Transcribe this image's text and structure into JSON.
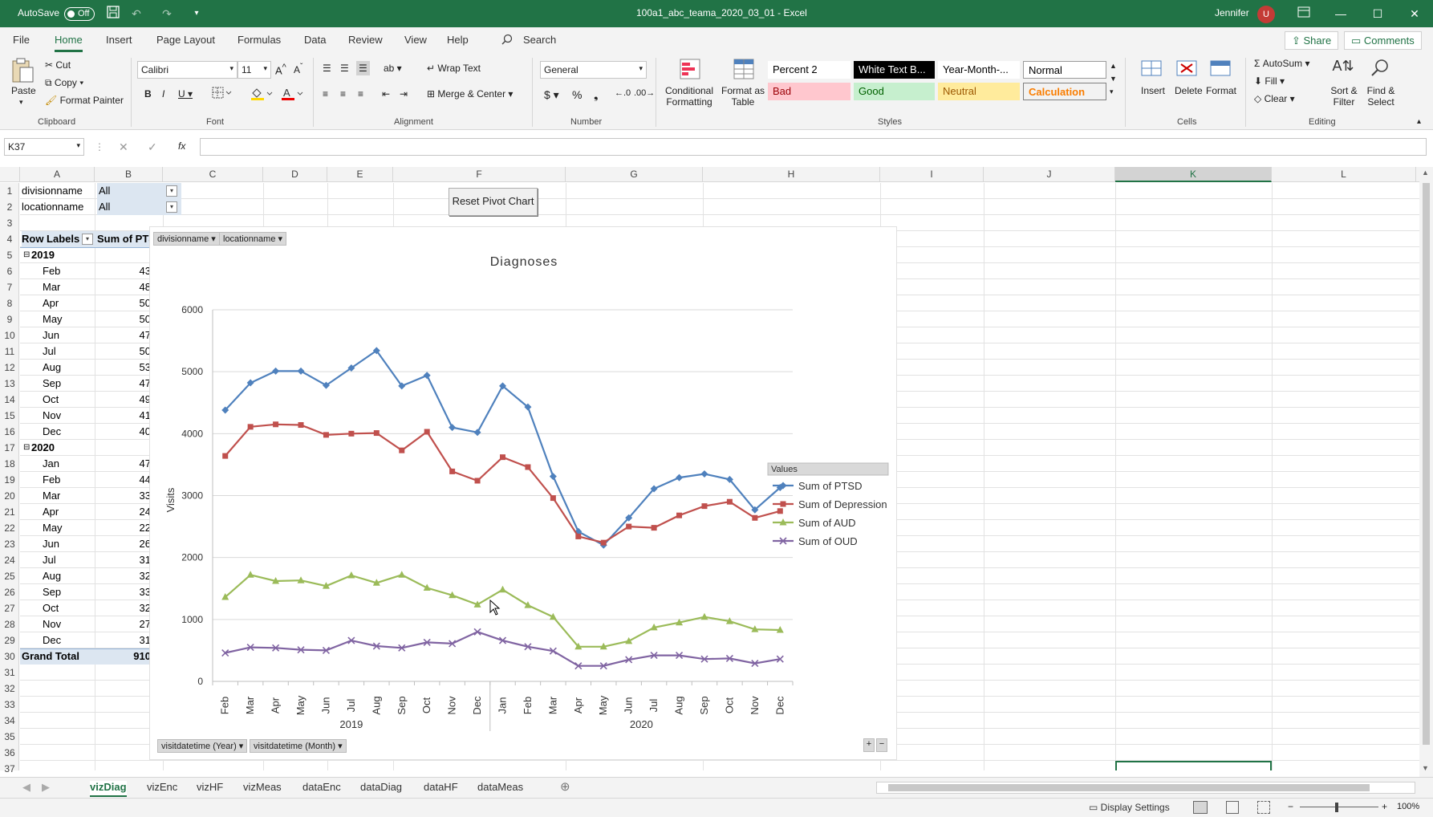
{
  "titlebar": {
    "autosave_label": "AutoSave",
    "autosave_state": "Off",
    "document_title": "100a1_abc_teama_2020_03_01  -  Excel",
    "user_name": "Jennifer",
    "user_initials": "U"
  },
  "menu": {
    "tabs": [
      "File",
      "Home",
      "Insert",
      "Page Layout",
      "Formulas",
      "Data",
      "Review",
      "View",
      "Help"
    ],
    "search_label": "Search",
    "share_label": "Share",
    "comments_label": "Comments"
  },
  "ribbon": {
    "clipboard": {
      "paste": "Paste",
      "cut": "Cut",
      "copy": "Copy",
      "format_painter": "Format Painter",
      "label": "Clipboard"
    },
    "font": {
      "name": "Calibri",
      "size": "11",
      "label": "Font"
    },
    "alignment": {
      "wrap_text": "Wrap Text",
      "merge_center": "Merge & Center",
      "label": "Alignment"
    },
    "number": {
      "format": "General",
      "label": "Number"
    },
    "styles": {
      "conditional": "Conditional Formatting",
      "format_table": "Format as Table",
      "cells": [
        "Percent 2",
        "White Text B...",
        "Year-Month-...",
        "Normal",
        "Bad",
        "Good",
        "Neutral",
        "Calculation"
      ],
      "label": "Styles"
    },
    "cells": {
      "insert": "Insert",
      "delete": "Delete",
      "format": "Format",
      "label": "Cells"
    },
    "editing": {
      "autosum": "AutoSum",
      "fill": "Fill",
      "clear": "Clear",
      "sort_filter": "Sort & Filter",
      "find_select": "Find & Select",
      "label": "Editing"
    }
  },
  "formula_bar": {
    "name_box": "K37",
    "fx": "fx",
    "value": ""
  },
  "columns": [
    "A",
    "B",
    "C",
    "D",
    "E",
    "F",
    "G",
    "H",
    "I",
    "J",
    "K",
    "L"
  ],
  "rows": [
    "1",
    "2",
    "3",
    "4",
    "5",
    "6",
    "7",
    "8",
    "9",
    "10",
    "11",
    "12",
    "13",
    "14",
    "15",
    "16",
    "17",
    "18",
    "19",
    "20",
    "21",
    "22",
    "23",
    "24",
    "25",
    "26",
    "27",
    "28",
    "29",
    "30",
    "31",
    "32",
    "33",
    "34",
    "35",
    "36",
    "37"
  ],
  "pivot": {
    "filter1_name": "divisionname",
    "filter1_value": "All",
    "filter2_name": "locationname",
    "filter2_value": "All",
    "row_labels": "Row Labels",
    "sum_header": "Sum of PTS",
    "year1": "2019",
    "year1_rows": [
      [
        "Feb",
        "43"
      ],
      [
        "Mar",
        "48"
      ],
      [
        "Apr",
        "50"
      ],
      [
        "May",
        "50"
      ],
      [
        "Jun",
        "47"
      ],
      [
        "Jul",
        "50"
      ],
      [
        "Aug",
        "53"
      ],
      [
        "Sep",
        "47"
      ],
      [
        "Oct",
        "49"
      ],
      [
        "Nov",
        "41"
      ],
      [
        "Dec",
        "40"
      ]
    ],
    "year2": "2020",
    "year2_rows": [
      [
        "Jan",
        "47"
      ],
      [
        "Feb",
        "44"
      ],
      [
        "Mar",
        "33"
      ],
      [
        "Apr",
        "24"
      ],
      [
        "May",
        "22"
      ],
      [
        "Jun",
        "26"
      ],
      [
        "Jul",
        "31"
      ],
      [
        "Aug",
        "32"
      ],
      [
        "Sep",
        "33"
      ],
      [
        "Oct",
        "32"
      ],
      [
        "Nov",
        "27"
      ],
      [
        "Dec",
        "31"
      ]
    ],
    "grand_total_label": "Grand Total",
    "grand_total_value": "910"
  },
  "reset_button": "Reset Pivot Chart",
  "chart_chips": {
    "top1": "divisionname",
    "top2": "locationname",
    "bottom1": "visitdatetime (Year)",
    "bottom2": "visitdatetime (Month)"
  },
  "chart_data": {
    "type": "line",
    "title": "Diagnoses",
    "ylabel": "Visits",
    "ylim": [
      0,
      6000
    ],
    "yticks": [
      0,
      1000,
      2000,
      3000,
      4000,
      5000,
      6000
    ],
    "categories": [
      "Feb",
      "Mar",
      "Apr",
      "May",
      "Jun",
      "Jul",
      "Aug",
      "Sep",
      "Oct",
      "Nov",
      "Dec",
      "Jan",
      "Feb",
      "Mar",
      "Apr",
      "May",
      "Jun",
      "Jul",
      "Aug",
      "Sep",
      "Oct",
      "Nov",
      "Dec"
    ],
    "groups": [
      {
        "label": "2019",
        "count": 11
      },
      {
        "label": "2020",
        "count": 12
      }
    ],
    "legend_title": "Values",
    "legend_position": "right",
    "series": [
      {
        "name": "Sum of PTSD",
        "color": "#4f81bd",
        "marker": "diamond",
        "values": [
          4380,
          4820,
          5010,
          5010,
          4780,
          5060,
          5340,
          4770,
          4940,
          4100,
          4020,
          4770,
          4430,
          3310,
          2420,
          2200,
          2640,
          3110,
          3290,
          3350,
          3260,
          2770,
          3130
        ]
      },
      {
        "name": "Sum of Depression",
        "color": "#c0504d",
        "marker": "square",
        "values": [
          3640,
          4110,
          4150,
          4140,
          3980,
          4000,
          4010,
          3730,
          4030,
          3390,
          3240,
          3620,
          3460,
          2960,
          2340,
          2240,
          2500,
          2480,
          2680,
          2830,
          2900,
          2640,
          2750
        ]
      },
      {
        "name": "Sum of AUD",
        "color": "#9bbb59",
        "marker": "triangle",
        "values": [
          1360,
          1720,
          1620,
          1630,
          1540,
          1710,
          1590,
          1720,
          1510,
          1390,
          1240,
          1480,
          1230,
          1040,
          560,
          560,
          650,
          870,
          950,
          1040,
          970,
          840,
          830
        ]
      },
      {
        "name": "Sum of OUD",
        "color": "#8064a2",
        "marker": "x",
        "values": [
          460,
          550,
          540,
          510,
          500,
          660,
          570,
          540,
          630,
          610,
          800,
          660,
          560,
          490,
          250,
          250,
          350,
          420,
          420,
          360,
          370,
          290,
          360
        ]
      }
    ]
  },
  "sheet_tabs": [
    "vizDiag",
    "vizEnc",
    "vizHF",
    "vizMeas",
    "dataEnc",
    "dataDiag",
    "dataHF",
    "dataMeas"
  ],
  "status": {
    "display_settings": "Display Settings",
    "zoom": "100%"
  }
}
